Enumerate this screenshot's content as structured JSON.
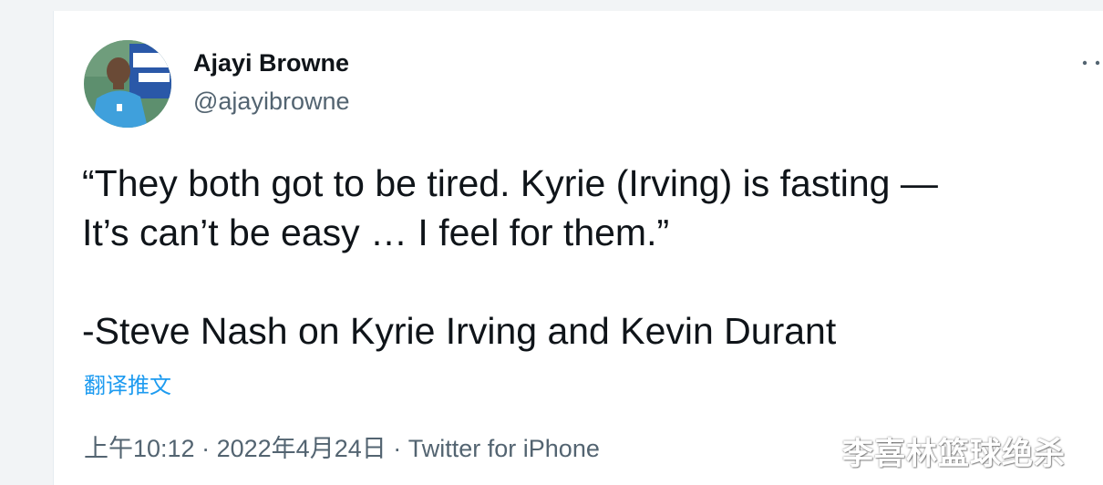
{
  "tweet": {
    "author": {
      "display_name": "Ajayi Browne",
      "handle": "@ajayibrowne",
      "avatar_icon": "profile-photo"
    },
    "more_icon": "more-options-icon",
    "text_lines": [
      "“They both got to be tired. Kyrie (Irving) is fasting —",
      "It’s can’t be easy … I feel for them.”",
      "-Steve Nash on Kyrie Irving and Kevin Durant"
    ],
    "translate_label": "翻译推文",
    "meta": {
      "time": "上午10:12",
      "separator": "·",
      "date": "2022年4月24日",
      "source": "Twitter for iPhone"
    }
  },
  "watermark": "李喜林篮球绝杀",
  "colors": {
    "background": "#f2f4f6",
    "card": "#ffffff",
    "text": "#0f1419",
    "secondary": "#536471",
    "link": "#1d9bf0"
  }
}
